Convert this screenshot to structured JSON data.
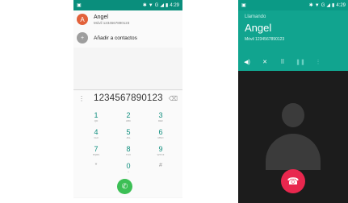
{
  "dialer": {
    "status_bar": {
      "time": "4:29",
      "network": "G"
    },
    "contact": {
      "initial": "A",
      "name": "Angel",
      "subtitle": "Móvil 1234567890123"
    },
    "add_contact_label": "Añadir a contactos",
    "number": "1234567890123",
    "keys": [
      {
        "digit": "1",
        "letters": "QD"
      },
      {
        "digit": "2",
        "letters": "ABC"
      },
      {
        "digit": "3",
        "letters": "DEF"
      },
      {
        "digit": "4",
        "letters": "GHI"
      },
      {
        "digit": "5",
        "letters": "JKL"
      },
      {
        "digit": "6",
        "letters": "MNO"
      },
      {
        "digit": "7",
        "letters": "PQRS"
      },
      {
        "digit": "8",
        "letters": "TUV"
      },
      {
        "digit": "9",
        "letters": "WXYZ"
      },
      {
        "digit": "*",
        "letters": ""
      },
      {
        "digit": "0",
        "letters": "+"
      },
      {
        "digit": "#",
        "letters": ""
      }
    ],
    "colors": {
      "accent": "#0f8e7e",
      "call_button": "#3cbf55",
      "avatar": "#e2613a"
    }
  },
  "in_call": {
    "status_bar": {
      "time": "4:29",
      "network": "G"
    },
    "status": "Llamando",
    "name": "Angel",
    "number": "Móvil 1234567890123",
    "controls": [
      "speaker-icon",
      "mute-icon",
      "dialpad-icon",
      "hold-icon",
      "more-icon"
    ],
    "colors": {
      "header": "#11a48f",
      "end_call_button": "#e8274e"
    }
  }
}
